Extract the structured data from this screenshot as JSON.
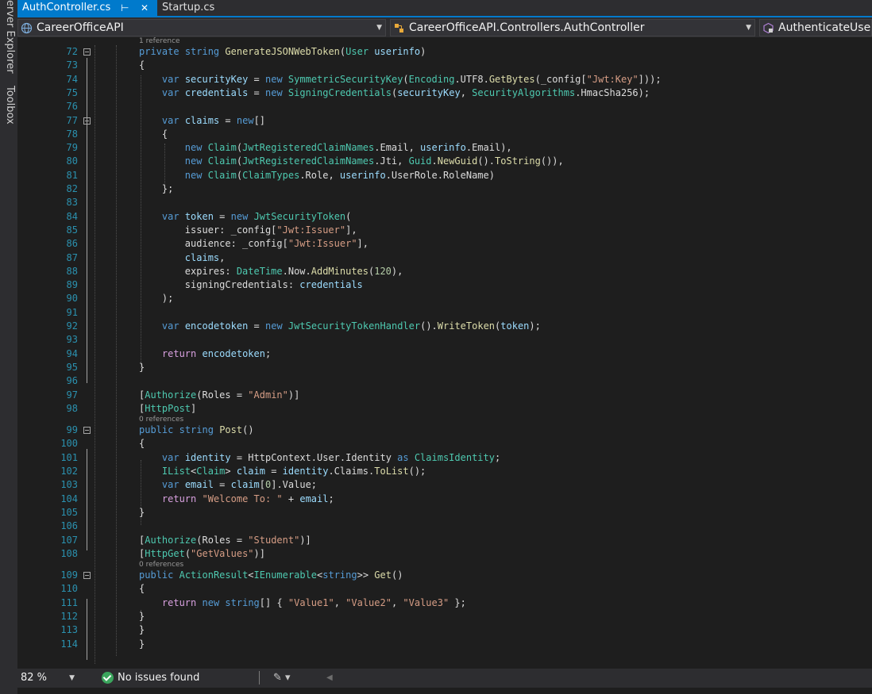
{
  "side_tabs": {
    "server_explorer": "erver Explorer",
    "toolbox": "Toolbox"
  },
  "tabs": [
    {
      "label": "AuthController.cs",
      "active": true,
      "pin_icon": "pin-icon",
      "close_icon": "close-icon"
    },
    {
      "label": "Startup.cs",
      "active": false
    }
  ],
  "nav": {
    "project": "CareerOfficeAPI",
    "type": "CareerOfficeAPI.Controllers.AuthController",
    "member": "AuthenticateUser("
  },
  "code_lines": [
    {
      "num": "",
      "lens": "1 reference"
    },
    {
      "num": "72",
      "html": "<span class=\"k\">private</span> <span class=\"k\">string</span> <span class=\"m\">GenerateJSONWebToken</span>(<span class=\"t\">User</span> <span class=\"v\">userinfo</span>)"
    },
    {
      "num": "73",
      "html": "{"
    },
    {
      "num": "74",
      "html": "    <span class=\"k\">var</span> <span class=\"v\">securityKey</span> = <span class=\"k\">new</span> <span class=\"t\">SymmetricSecurityKey</span>(<span class=\"t\">Encoding</span>.UTF8.<span class=\"m\">GetBytes</span>(_config[<span class=\"s\">\"Jwt:Key\"</span>]));"
    },
    {
      "num": "75",
      "html": "    <span class=\"k\">var</span> <span class=\"v\">credentials</span> = <span class=\"k\">new</span> <span class=\"t\">SigningCredentials</span>(<span class=\"v\">securityKey</span>, <span class=\"t\">SecurityAlgorithms</span>.HmacSha256);"
    },
    {
      "num": "76",
      "html": ""
    },
    {
      "num": "77",
      "html": "    <span class=\"k\">var</span> <span class=\"v\">claims</span> = <span class=\"k\">new</span>[]"
    },
    {
      "num": "78",
      "html": "    {"
    },
    {
      "num": "79",
      "html": "        <span class=\"k\">new</span> <span class=\"t\">Claim</span>(<span class=\"t\">JwtRegisteredClaimNames</span>.Email, <span class=\"v\">userinfo</span>.Email),"
    },
    {
      "num": "80",
      "html": "        <span class=\"k\">new</span> <span class=\"t\">Claim</span>(<span class=\"t\">JwtRegisteredClaimNames</span>.Jti, <span class=\"t\">Guid</span>.<span class=\"m\">NewGuid</span>().<span class=\"m\">ToString</span>()),"
    },
    {
      "num": "81",
      "html": "        <span class=\"k\">new</span> <span class=\"t\">Claim</span>(<span class=\"t\">ClaimTypes</span>.Role, <span class=\"v\">userinfo</span>.UserRole.RoleName)"
    },
    {
      "num": "82",
      "html": "    };"
    },
    {
      "num": "83",
      "html": ""
    },
    {
      "num": "84",
      "html": "    <span class=\"k\">var</span> <span class=\"v\">token</span> = <span class=\"k\">new</span> <span class=\"t\">JwtSecurityToken</span>("
    },
    {
      "num": "85",
      "html": "        issuer: _config[<span class=\"s\">\"Jwt:Issuer\"</span>],"
    },
    {
      "num": "86",
      "html": "        audience: _config[<span class=\"s\">\"Jwt:Issuer\"</span>],"
    },
    {
      "num": "87",
      "html": "        <span class=\"v\">claims</span>,"
    },
    {
      "num": "88",
      "html": "        expires: <span class=\"t\">DateTime</span>.Now.<span class=\"m\">AddMinutes</span>(<span class=\"n\">120</span>),"
    },
    {
      "num": "89",
      "html": "        signingCredentials: <span class=\"v\">credentials</span>"
    },
    {
      "num": "90",
      "html": "    );"
    },
    {
      "num": "91",
      "html": ""
    },
    {
      "num": "92",
      "html": "    <span class=\"k\">var</span> <span class=\"v\">encodetoken</span> = <span class=\"k\">new</span> <span class=\"t\">JwtSecurityTokenHandler</span>().<span class=\"m\">WriteToken</span>(<span class=\"v\">token</span>);"
    },
    {
      "num": "93",
      "html": ""
    },
    {
      "num": "94",
      "html": "    <span class=\"kc\">return</span> <span class=\"v\">encodetoken</span>;"
    },
    {
      "num": "95",
      "html": "}"
    },
    {
      "num": "96",
      "html": ""
    },
    {
      "num": "97",
      "html": "[<span class=\"t\">Authorize</span>(Roles = <span class=\"s\">\"Admin\"</span>)]"
    },
    {
      "num": "98",
      "html": "[<span class=\"t\">HttpPost</span>]"
    },
    {
      "num": "",
      "lens": "0 references"
    },
    {
      "num": "99",
      "html": "<span class=\"k\">public</span> <span class=\"k\">string</span> <span class=\"m\">Post</span>()"
    },
    {
      "num": "100",
      "html": "{"
    },
    {
      "num": "101",
      "html": "    <span class=\"k\">var</span> <span class=\"v\">identity</span> = HttpContext.User.Identity <span class=\"k\">as</span> <span class=\"t\">ClaimsIdentity</span>;"
    },
    {
      "num": "102",
      "html": "    <span class=\"t\">IList</span>&lt;<span class=\"t\">Claim</span>&gt; <span class=\"v\">claim</span> = <span class=\"v\">identity</span>.Claims.<span class=\"m\">ToList</span>();"
    },
    {
      "num": "103",
      "html": "    <span class=\"k\">var</span> <span class=\"v\">email</span> = <span class=\"v\">claim</span>[<span class=\"n\">0</span>].Value;"
    },
    {
      "num": "104",
      "html": "    <span class=\"kc\">return</span> <span class=\"s\">\"Welcome To: \"</span> + <span class=\"v\">email</span>;"
    },
    {
      "num": "105",
      "html": "}"
    },
    {
      "num": "106",
      "html": ""
    },
    {
      "num": "107",
      "html": "[<span class=\"t\">Authorize</span>(Roles = <span class=\"s\">\"Student\"</span>)]"
    },
    {
      "num": "108",
      "html": "[<span class=\"t\">HttpGet</span>(<span class=\"s\">\"GetValues\"</span>)]"
    },
    {
      "num": "",
      "lens": "0 references"
    },
    {
      "num": "109",
      "html": "<span class=\"k\">public</span> <span class=\"t\">ActionResult</span>&lt;<span class=\"t\">IEnumerable</span>&lt;<span class=\"k\">string</span>&gt;&gt; <span class=\"m\">Get</span>()"
    },
    {
      "num": "110",
      "html": "{"
    },
    {
      "num": "111",
      "html": "    <span class=\"kc\">return</span> <span class=\"k\">new</span> <span class=\"k\">string</span>[] { <span class=\"s\">\"Value1\"</span>, <span class=\"s\">\"Value2\"</span>, <span class=\"s\">\"Value3\"</span> };"
    },
    {
      "num": "112",
      "html": "}"
    },
    {
      "num": "113",
      "html": "}"
    },
    {
      "num": "114",
      "html": "}"
    }
  ],
  "status": {
    "zoom": "82 %",
    "issues": "No issues found",
    "issues_icon": "check-circle-icon"
  },
  "colors": {
    "accent": "#007acc",
    "background": "#1e1e1e",
    "chrome": "#2d2d30",
    "line_number": "#2b91af",
    "keyword": "#569cd6",
    "type": "#4ec9b0",
    "string": "#d69d85",
    "method": "#dcdcaa",
    "variable": "#9cdcfe"
  }
}
